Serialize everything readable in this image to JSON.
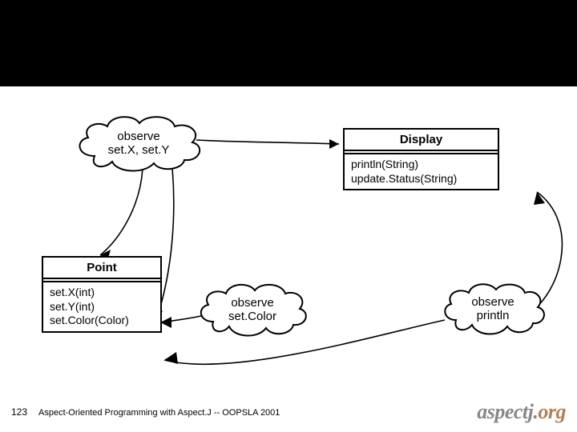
{
  "clouds": {
    "setxy": {
      "line1": "observe",
      "line2": "set.X, set.Y"
    },
    "setcolor": {
      "line1": "observe",
      "line2": "set.Color"
    },
    "println": {
      "line1": "observe",
      "line2": "println"
    }
  },
  "uml": {
    "display": {
      "title": "Display",
      "methods": "println(String)\nupdate.Status(String)"
    },
    "point": {
      "title": "Point",
      "methods": "set.X(int)\nset.Y(int)\nset.Color(Color)"
    }
  },
  "footer": {
    "page": "123",
    "text": "Aspect-Oriented Programming with Aspect.J -- OOPSLA 2001",
    "logo_main": "aspectj.",
    "logo_tld": "org"
  }
}
